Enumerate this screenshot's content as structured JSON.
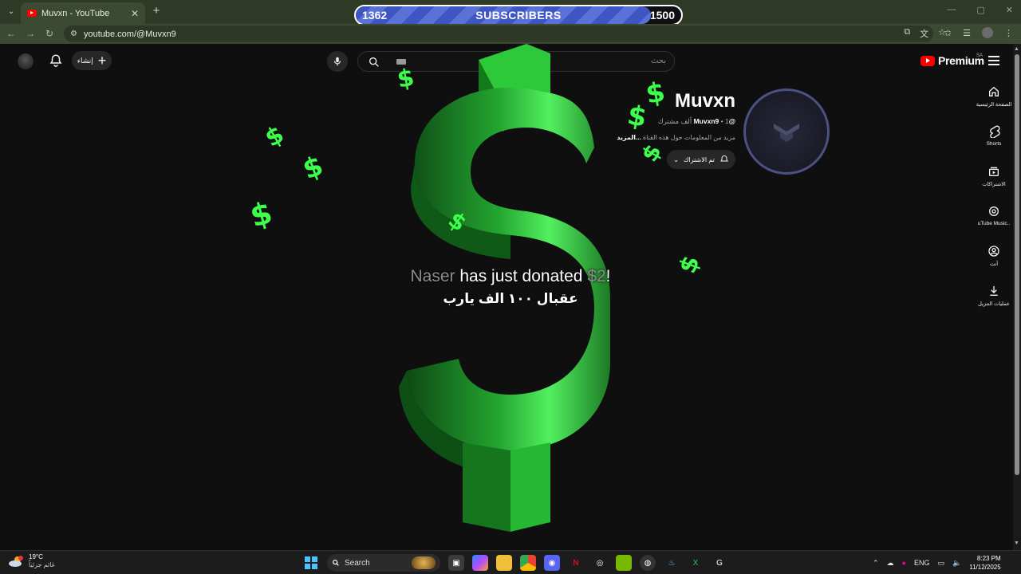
{
  "browser": {
    "tab_title": "Muvxn - YouTube",
    "url": "youtube.com/@Muvxn9"
  },
  "goal": {
    "current": "1362",
    "label": "SUBSCRIBERS",
    "target": "1500",
    "progress_fraction": 0.908
  },
  "youtube": {
    "create_label": "إنشاء",
    "search_placeholder": "بحث",
    "premium_label": "Premium",
    "region_code": "SA",
    "guide": [
      {
        "label": "الصفحة الرئيسية",
        "icon": "home-icon"
      },
      {
        "label": "Shorts",
        "icon": "shorts-icon"
      },
      {
        "label": "الاشتراكات",
        "icon": "subscriptions-icon"
      },
      {
        "label": "uTube Music..",
        "icon": "music-icon"
      },
      {
        "label": "أنت",
        "icon": "you-icon"
      },
      {
        "label": "عمليات التنزيل",
        "icon": "download-icon"
      }
    ],
    "channel": {
      "name": "Muvxn",
      "handle": "@Muvxn9",
      "subscribers": "1 ألف مشترك",
      "description": "مزيد من المعلومات حول هذه القناة",
      "more_label": "...المزيد",
      "subscribed_label": "تم الاشتراك"
    }
  },
  "alert": {
    "donor": "Naser",
    "middle": " has just donated ",
    "amount": "$2",
    "end": "!",
    "message": "عقبال ١٠٠ الف يارب"
  },
  "taskbar": {
    "weather_temp": "19°C",
    "weather_desc": "غائم جزئياً",
    "search_label": "Search",
    "language": "ENG",
    "time": "8:23 PM",
    "date": "11/12/2025"
  }
}
